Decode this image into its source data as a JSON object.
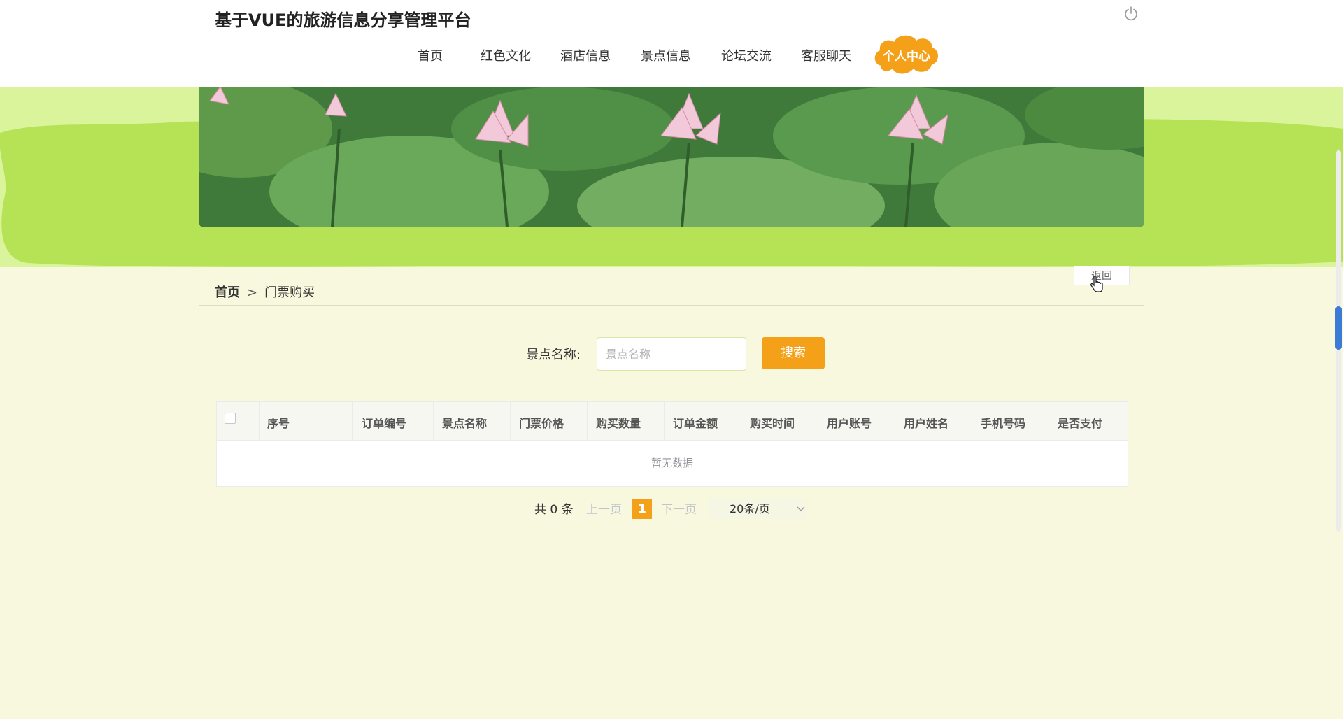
{
  "header": {
    "title": "基于VUE的旅游信息分享管理平台",
    "nav": [
      "首页",
      "红色文化",
      "酒店信息",
      "景点信息",
      "论坛交流",
      "客服聊天"
    ],
    "cta_label": "个人中心"
  },
  "breadcrumb": {
    "home": "首页",
    "separator": ">",
    "current": "门票购买"
  },
  "back_label": "返回",
  "search": {
    "label": "景点名称:",
    "placeholder": "景点名称",
    "value": "",
    "button": "搜索"
  },
  "table": {
    "columns": [
      "序号",
      "订单编号",
      "景点名称",
      "门票价格",
      "购买数量",
      "订单金额",
      "购买时间",
      "用户账号",
      "用户姓名",
      "手机号码",
      "是否支付"
    ],
    "empty_text": "暂无数据"
  },
  "pagination": {
    "total": "共 0 条",
    "prev": "上一页",
    "current": "1",
    "next": "下一页",
    "page_size": "20条/页"
  },
  "colors": {
    "accent": "#f4a018",
    "banner_green": "#b6e356",
    "page_bg": "#f8f8df"
  },
  "icons": [
    "power-icon",
    "chevron-down-icon",
    "cursor-icon"
  ]
}
